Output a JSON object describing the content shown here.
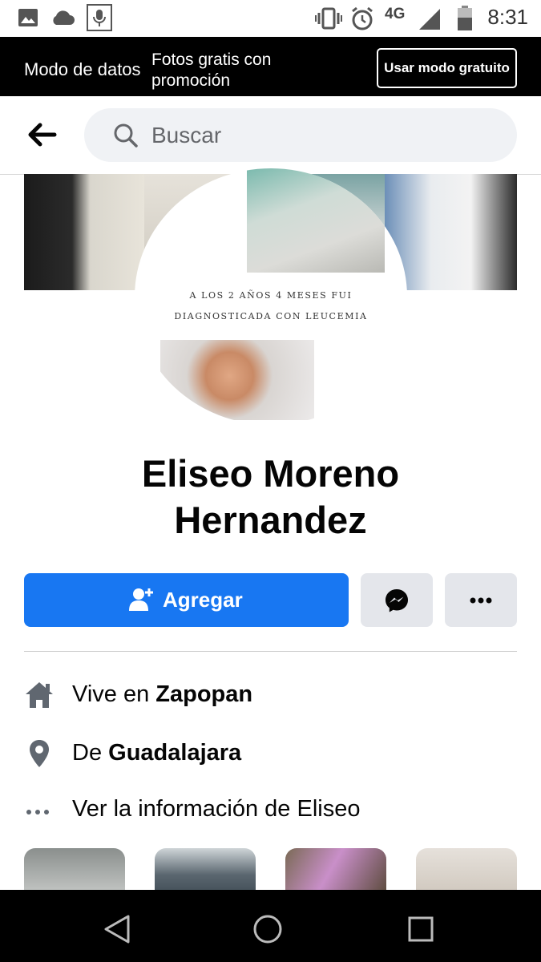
{
  "status_bar": {
    "time": "8:31",
    "network": "4G",
    "icons": [
      "image-icon",
      "cloud-icon",
      "voice-icon",
      "vibrate-icon",
      "alarm-icon",
      "signal-icon",
      "battery-icon"
    ]
  },
  "banner": {
    "mode_label": "Modo de datos",
    "promo_text": "Fotos gratis con promoción",
    "button_label": "Usar modo gratuito"
  },
  "header": {
    "search_placeholder": "Buscar"
  },
  "profile": {
    "image_caption_line1": "A LOS 2 AÑOS 4 MESES FUI",
    "image_caption_line2": "DIAGNOSTICADA CON LEUCEMIA",
    "name_line1": "Eliseo Moreno",
    "name_line2": "Hernandez"
  },
  "actions": {
    "add_label": "Agregar"
  },
  "info": {
    "lives_prefix": "Vive en ",
    "lives_place": "Zapopan",
    "from_prefix": "De ",
    "from_place": "Guadalajara",
    "see_info": "Ver la información de Eliseo"
  },
  "colors": {
    "primary": "#1877f2",
    "secondary_button": "#e4e6eb",
    "banner_bg": "#000000"
  }
}
